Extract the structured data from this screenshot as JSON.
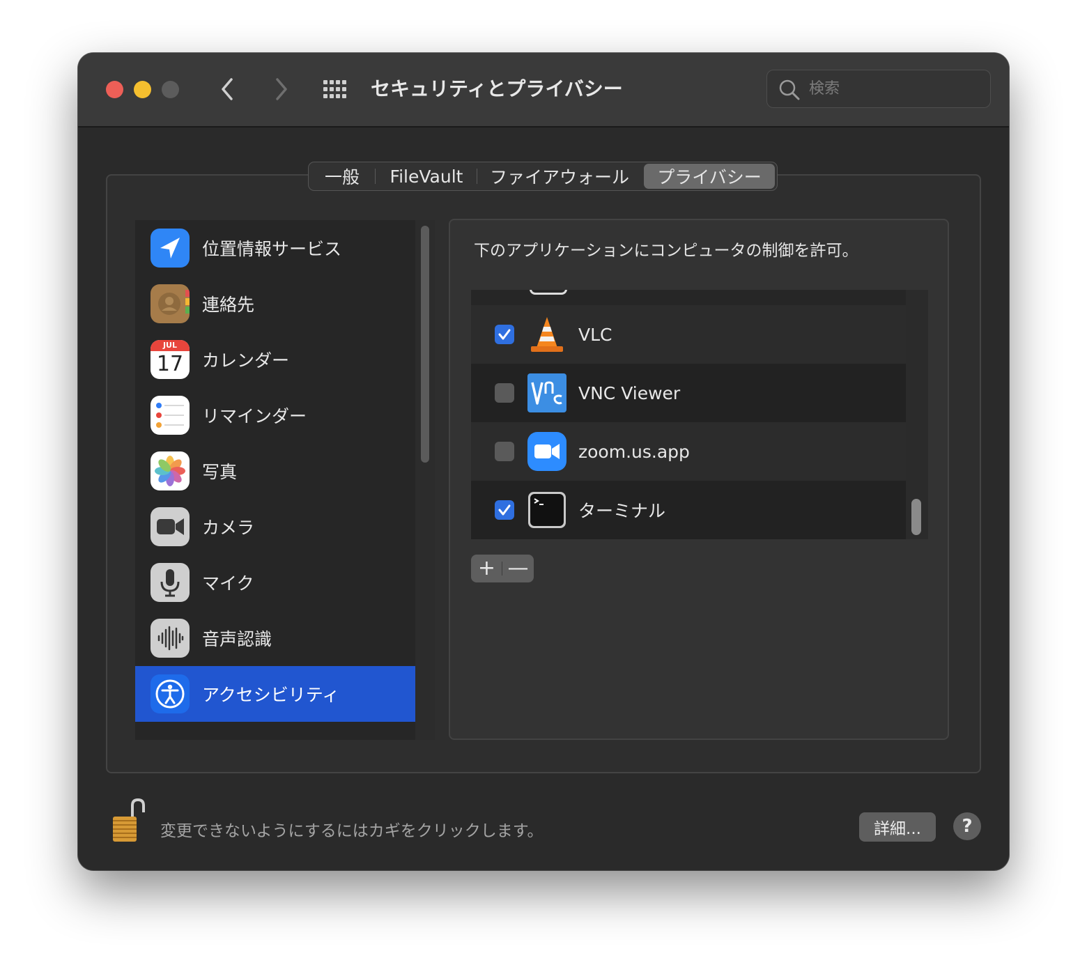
{
  "window": {
    "title": "セキュリティとプライバシー",
    "search_placeholder": "検索"
  },
  "tabs": [
    {
      "label": "一般",
      "active": false
    },
    {
      "label": "FileVault",
      "active": false
    },
    {
      "label": "ファイアウォール",
      "active": false
    },
    {
      "label": "プライバシー",
      "active": true
    }
  ],
  "sidebar": {
    "items": [
      {
        "label": "位置情報サービス",
        "icon": "location-arrow-icon"
      },
      {
        "label": "連絡先",
        "icon": "contacts-icon"
      },
      {
        "label": "カレンダー",
        "icon": "calendar-icon",
        "calendar_month": "JUL",
        "calendar_day": "17"
      },
      {
        "label": "リマインダー",
        "icon": "reminders-icon"
      },
      {
        "label": "写真",
        "icon": "photos-icon"
      },
      {
        "label": "カメラ",
        "icon": "camera-icon"
      },
      {
        "label": "マイク",
        "icon": "microphone-icon"
      },
      {
        "label": "音声認識",
        "icon": "speech-recognition-icon"
      },
      {
        "label": "アクセシビリティ",
        "icon": "accessibility-icon",
        "selected": true
      }
    ]
  },
  "main": {
    "description": "下のアプリケーションにコンピュータの制御を許可。",
    "apps": [
      {
        "name": "VLC",
        "checked": true,
        "icon": "vlc-icon"
      },
      {
        "name": "VNC Viewer",
        "checked": false,
        "icon": "vnc-viewer-icon"
      },
      {
        "name": "zoom.us.app",
        "checked": false,
        "icon": "zoom-icon"
      },
      {
        "name": "ターミナル",
        "checked": true,
        "icon": "terminal-icon"
      }
    ],
    "add_label": "+",
    "remove_label": "—"
  },
  "footer": {
    "lock_text": "変更できないようにするにはカギをクリックします。",
    "details_label": "詳細...",
    "help_label": "?"
  },
  "colors": {
    "selection": "#2156d0",
    "checkbox_on": "#2f6fe0",
    "close": "#ed5f57",
    "minimize": "#f5bf2f"
  }
}
